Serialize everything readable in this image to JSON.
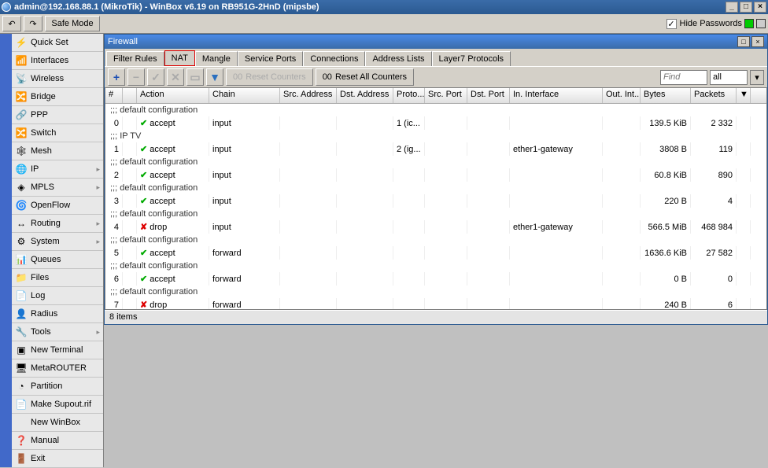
{
  "title": "admin@192.168.88.1 (MikroTik) - WinBox v6.19 on RB951G-2HnD (mipsbe)",
  "toolbar": {
    "undo": "↶",
    "redo": "↷",
    "safemode": "Safe Mode",
    "hidepw_label": "Hide Passwords",
    "hidepw_checked": "✓"
  },
  "sidebar": [
    {
      "icon": "⚡",
      "label": "Quick Set",
      "sub": false
    },
    {
      "icon": "📶",
      "label": "Interfaces",
      "sub": false
    },
    {
      "icon": "📡",
      "label": "Wireless",
      "sub": false
    },
    {
      "icon": "🔀",
      "label": "Bridge",
      "sub": false
    },
    {
      "icon": "🔗",
      "label": "PPP",
      "sub": false
    },
    {
      "icon": "🔀",
      "label": "Switch",
      "sub": false
    },
    {
      "icon": "🕸",
      "label": "Mesh",
      "sub": false
    },
    {
      "icon": "🌐",
      "label": "IP",
      "sub": true
    },
    {
      "icon": "◈",
      "label": "MPLS",
      "sub": true
    },
    {
      "icon": "🌀",
      "label": "OpenFlow",
      "sub": false
    },
    {
      "icon": "↔",
      "label": "Routing",
      "sub": true
    },
    {
      "icon": "⚙",
      "label": "System",
      "sub": true
    },
    {
      "icon": "📊",
      "label": "Queues",
      "sub": false
    },
    {
      "icon": "📁",
      "label": "Files",
      "sub": false
    },
    {
      "icon": "📄",
      "label": "Log",
      "sub": false
    },
    {
      "icon": "👤",
      "label": "Radius",
      "sub": false
    },
    {
      "icon": "🔧",
      "label": "Tools",
      "sub": true
    },
    {
      "icon": "▣",
      "label": "New Terminal",
      "sub": false
    },
    {
      "icon": "🖥",
      "label": "MetaROUTER",
      "sub": false
    },
    {
      "icon": "◔",
      "label": "Partition",
      "sub": false
    },
    {
      "icon": "📄",
      "label": "Make Supout.rif",
      "sub": false
    },
    {
      "icon": "",
      "label": "New WinBox",
      "sub": false
    },
    {
      "icon": "❓",
      "label": "Manual",
      "sub": false
    },
    {
      "icon": "🚪",
      "label": "Exit",
      "sub": false
    }
  ],
  "firewall": {
    "title": "Firewall",
    "tabs": [
      "Filter Rules",
      "NAT",
      "Mangle",
      "Service Ports",
      "Connections",
      "Address Lists",
      "Layer7 Protocols"
    ],
    "btn_reset": "Reset Counters",
    "btn_reset_all": "Reset All Counters",
    "find_placeholder": "Find",
    "filter_value": "all",
    "columns": [
      "#",
      "",
      "Action",
      "Chain",
      "Src. Address",
      "Dst. Address",
      "Proto...",
      "Src. Port",
      "Dst. Port",
      "In. Interface",
      "Out. Int...",
      "Bytes",
      "Packets",
      "▼"
    ],
    "rows": [
      {
        "group": ";;; default configuration"
      },
      {
        "num": "0",
        "icon": "tick",
        "action": "accept",
        "chain": "input",
        "proto": "1 (ic...",
        "bytes": "139.5 KiB",
        "packets": "2 332"
      },
      {
        "group": ";;; IP TV"
      },
      {
        "num": "1",
        "icon": "tick",
        "action": "accept",
        "chain": "input",
        "proto": "2 (ig...",
        "inif": "ether1-gateway",
        "bytes": "3808 B",
        "packets": "119"
      },
      {
        "group": ";;; default configuration"
      },
      {
        "num": "2",
        "icon": "tick",
        "action": "accept",
        "chain": "input",
        "bytes": "60.8 KiB",
        "packets": "890"
      },
      {
        "group": ";;; default configuration"
      },
      {
        "num": "3",
        "icon": "tick",
        "action": "accept",
        "chain": "input",
        "bytes": "220 B",
        "packets": "4"
      },
      {
        "group": ";;; default configuration"
      },
      {
        "num": "4",
        "icon": "cross",
        "action": "drop",
        "chain": "input",
        "inif": "ether1-gateway",
        "bytes": "566.5 MiB",
        "packets": "468 984"
      },
      {
        "group": ";;; default configuration"
      },
      {
        "num": "5",
        "icon": "tick",
        "action": "accept",
        "chain": "forward",
        "bytes": "1636.6 KiB",
        "packets": "27 582"
      },
      {
        "group": ";;; default configuration"
      },
      {
        "num": "6",
        "icon": "tick",
        "action": "accept",
        "chain": "forward",
        "bytes": "0 B",
        "packets": "0"
      },
      {
        "group": ";;; default configuration"
      },
      {
        "num": "7",
        "icon": "cross",
        "action": "drop",
        "chain": "forward",
        "bytes": "240 B",
        "packets": "6"
      }
    ],
    "status": "8 items"
  }
}
